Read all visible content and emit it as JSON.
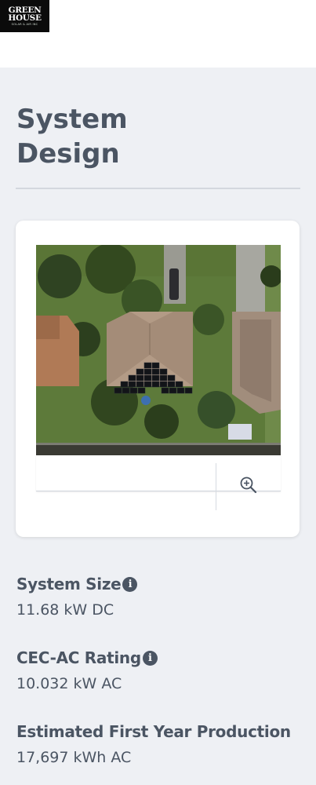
{
  "logo": {
    "line1": "GREEN",
    "line2": "HOUSE",
    "tagline": "SOLAR & AIR INC"
  },
  "page": {
    "title": "System\nDesign"
  },
  "specs": [
    {
      "label": "System Size",
      "value": "11.68 kW DC",
      "icon": "info-icon"
    },
    {
      "label": "CEC-AC Rating",
      "value": "10.032 kW AC",
      "icon": "info-icon"
    },
    {
      "label": "Estimated First Year Production",
      "value": "17,697 kWh AC"
    }
  ],
  "map": {
    "zoom_icon": "zoom-in-icon"
  },
  "colors": {
    "background": "#eef0f4",
    "text": "#4b5563",
    "card": "#ffffff",
    "logo_bg": "#0b0b0b"
  }
}
